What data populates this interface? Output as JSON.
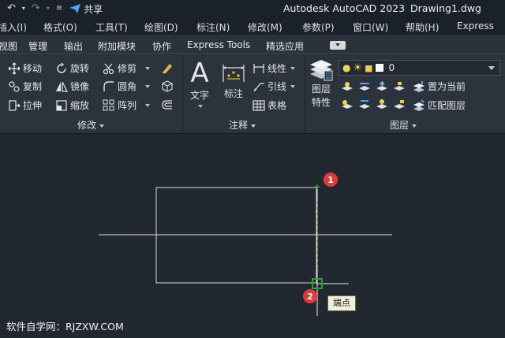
{
  "titlebar": {
    "app_title": "Autodesk AutoCAD 2023",
    "file_name": "Drawing1.dwg",
    "share_label": "共享"
  },
  "menu": {
    "items": [
      "插入(I)",
      "格式(O)",
      "工具(T)",
      "绘图(D)",
      "标注(N)",
      "修改(M)",
      "参数(P)",
      "窗口(W)",
      "帮助(H)",
      "Express"
    ]
  },
  "tabs": {
    "items": [
      "视图",
      "管理",
      "输出",
      "附加模块",
      "协作",
      "Express Tools",
      "精选应用"
    ]
  },
  "modify_panel": {
    "title": "修改",
    "move": "移动",
    "rotate": "旋转",
    "trim": "修剪",
    "copy": "复制",
    "mirror": "镜像",
    "fillet": "圆角",
    "stretch": "拉伸",
    "scale": "缩放",
    "array": "阵列"
  },
  "annotation_panel": {
    "title": "注释",
    "text": "文字",
    "dimension": "标注",
    "linear": "线性",
    "leader": "引线",
    "table": "表格"
  },
  "layers_panel": {
    "title": "图层",
    "properties_line1": "图层",
    "properties_line2": "特性",
    "current_layer": "0",
    "set_current": "置为当前",
    "match_layer": "匹配图层"
  },
  "canvas": {
    "marker1": "1",
    "marker2": "2",
    "snap_tooltip": "端点"
  },
  "watermark": "软件自学网：RJZXW.COM",
  "colors": {
    "background": "#212830",
    "ribbon": "#2b333d",
    "badge": "#e23a3a",
    "snap": "#2ea02e"
  }
}
